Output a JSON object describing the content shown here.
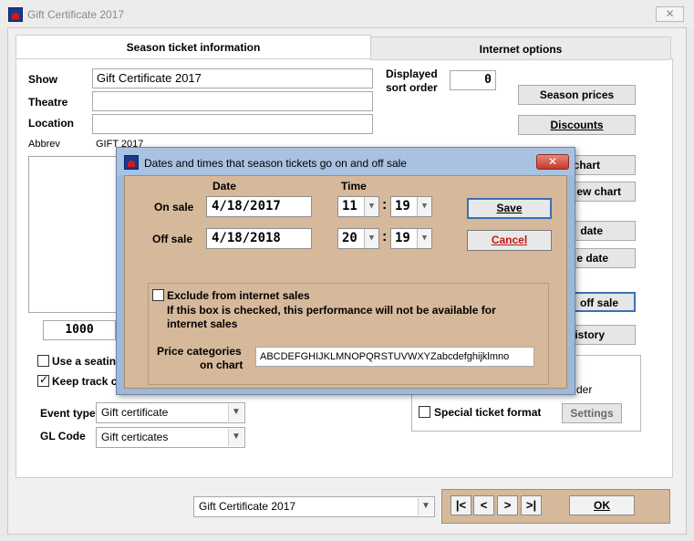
{
  "window": {
    "title": "Gift Certificate 2017",
    "close_glyph": "✕"
  },
  "tabs": [
    {
      "label": "Season ticket information",
      "active": true
    },
    {
      "label": "Internet options",
      "active": false
    }
  ],
  "form": {
    "show_label": "Show",
    "show_value": "Gift Certificate 2017",
    "theatre_label": "Theatre",
    "theatre_value": "",
    "location_label": "Location",
    "location_value": "",
    "abbrev_label": "Abbrev",
    "abbrev_value": "GIFT 2017",
    "displayed_sort_label_1": "Displayed",
    "displayed_sort_label_2": "sort order",
    "displayed_sort_value": "0",
    "number_field_value": "1000",
    "use_seating_label": "Use a seatin",
    "use_seating_checked": false,
    "keep_track_label": "Keep track c",
    "keep_track_checked": true,
    "event_type_label": "Event type",
    "event_type_value": "Gift certificate",
    "gl_code_label": "GL Code",
    "gl_code_value": "Gift certicates",
    "special_ticket_label": "Special ticket format",
    "special_ticket_checked": false,
    "settings_label": "Settings",
    "order_label_fragment": "der"
  },
  "right_buttons": {
    "season_prices": "Season prices",
    "discounts": "Discounts",
    "chart": "chart",
    "view_chart": "ew chart",
    "date1": "date",
    "date2": "e date",
    "off_sale": "off sale",
    "history": "istory"
  },
  "dialog": {
    "title": "Dates and times that season tickets go on and off sale",
    "close_glyph": "✕",
    "date_header": "Date",
    "time_header": "Time",
    "on_sale_label": "On sale",
    "on_sale_date": "4/18/2017",
    "on_sale_hour": "11",
    "on_sale_minute": "19",
    "off_sale_label": "Off sale",
    "off_sale_date": "4/18/2018",
    "off_sale_hour": "20",
    "off_sale_minute": "19",
    "time_separator": ":",
    "save_label": "Save",
    "cancel_label": "Cancel",
    "exclude_label": "Exclude from internet sales",
    "exclude_checked": false,
    "exclude_note_1": "If this box is checked, this performance will not be available for",
    "exclude_note_2": "internet sales",
    "price_cat_label_1": "Price categories",
    "price_cat_label_2": "on chart",
    "price_cat_value": "ABCDEFGHIJKLMNOPQRSTUVWXYZabcdefghijklmno"
  },
  "footer": {
    "show_select_value": "Gift Certificate 2017",
    "nav_first": "|<",
    "nav_prev": "<",
    "nav_next": ">",
    "nav_last": ">|",
    "ok_label": "OK"
  },
  "colors": {
    "dialog_title": "#a9c2e0",
    "dialog_body": "#d6b89a",
    "close_red": "#c4392b",
    "cancel_text": "#c01818"
  }
}
